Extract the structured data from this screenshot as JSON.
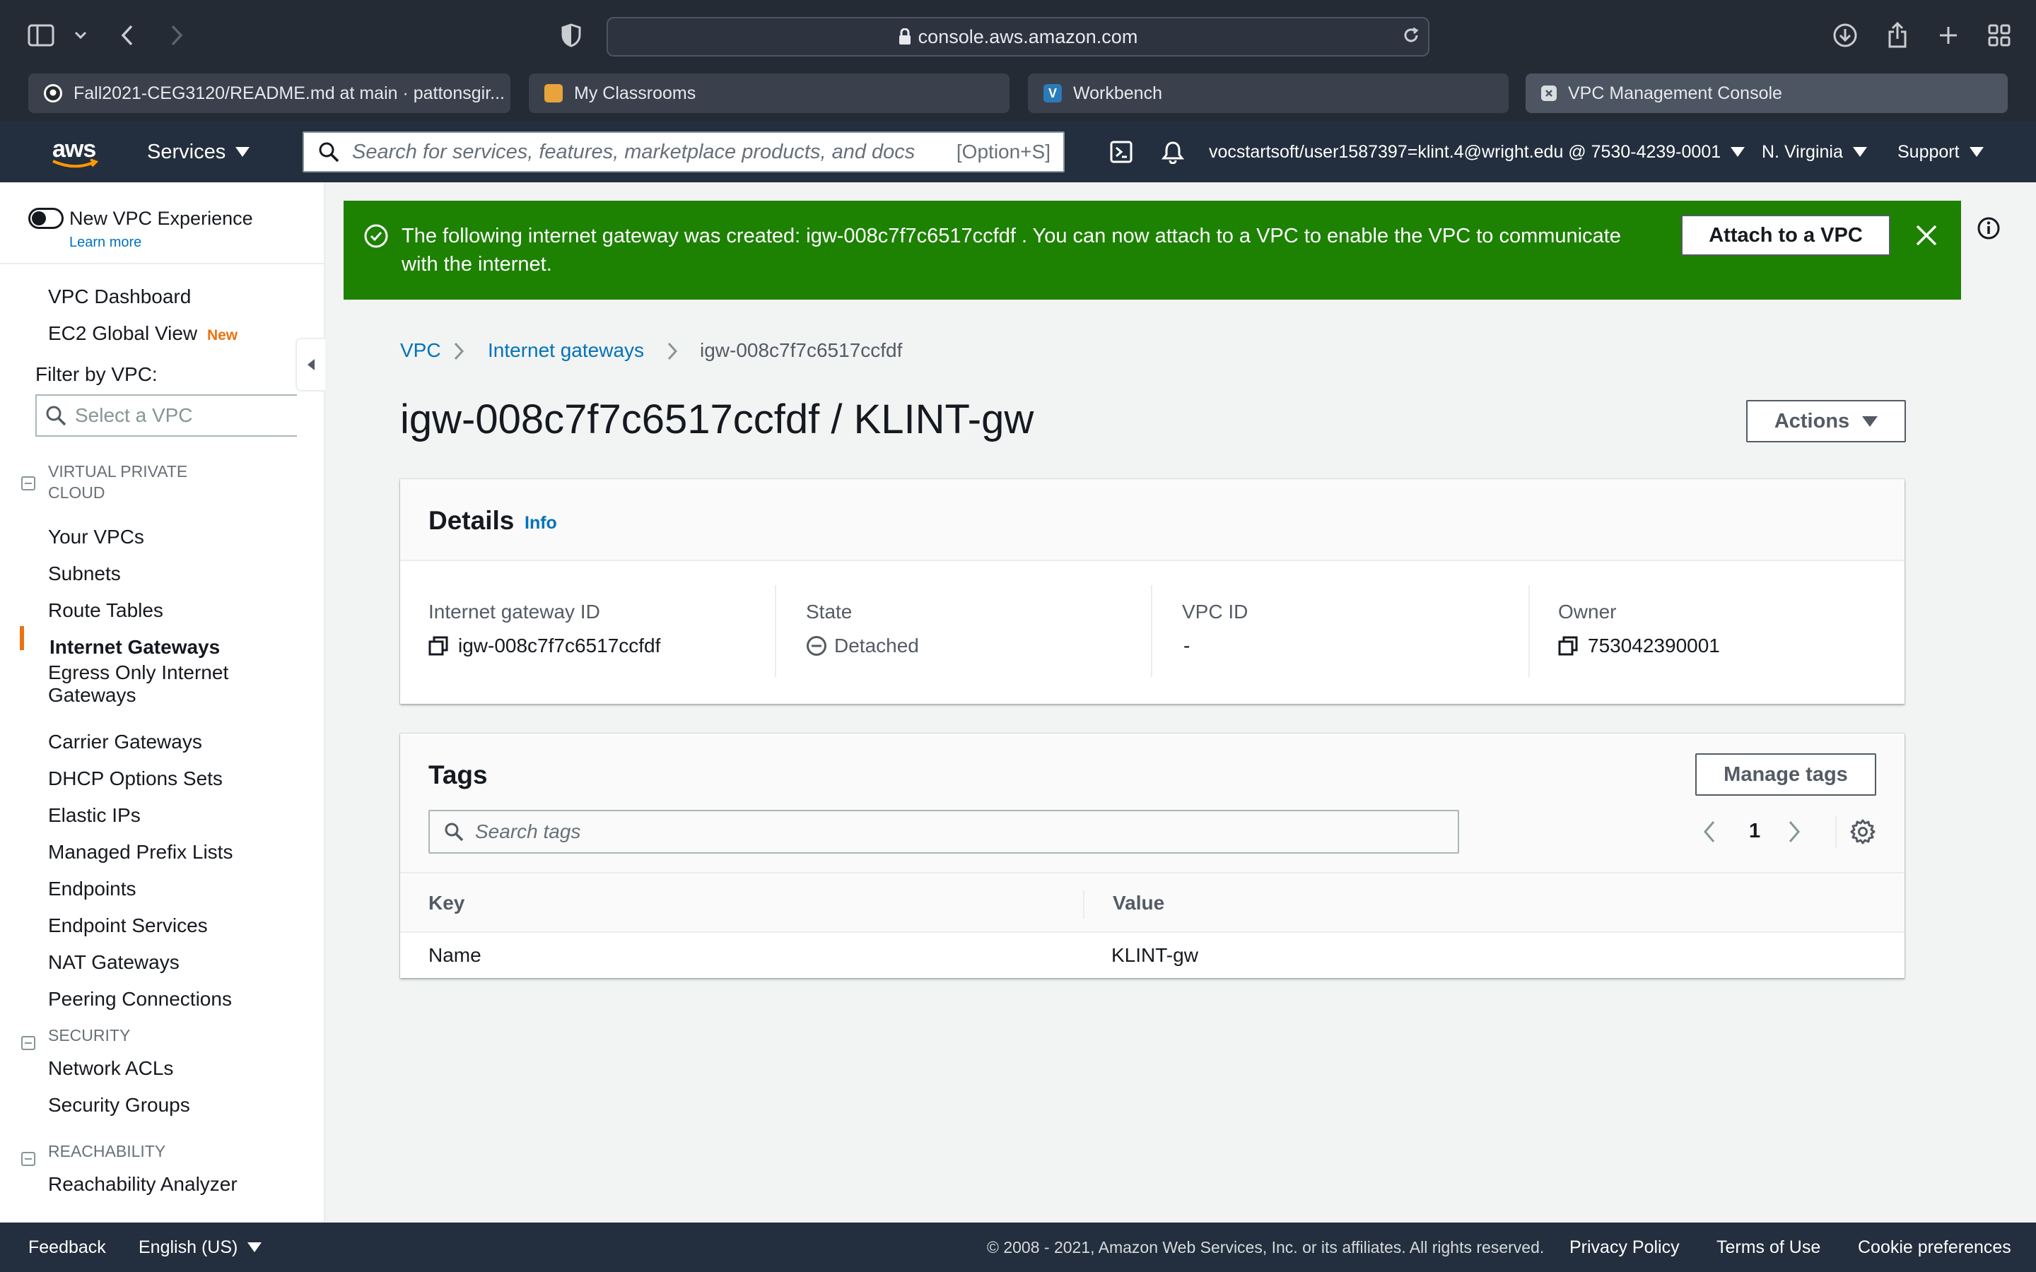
{
  "browser": {
    "url": "console.aws.amazon.com",
    "tabs": [
      {
        "label": "Fall2021-CEG3120/README.md at main · pattonsgir..."
      },
      {
        "label": "My Classrooms"
      },
      {
        "label": "Workbench"
      },
      {
        "label": "VPC Management Console"
      }
    ]
  },
  "aws_nav": {
    "logo": "aws",
    "services": "Services",
    "search_placeholder": "Search for services, features, marketplace products, and docs",
    "search_shortcut": "[Option+S]",
    "account": "vocstartsoft/user1587397=klint.4@wright.edu @ 7530-4239-0001",
    "region": "N. Virginia",
    "support": "Support"
  },
  "sidebar": {
    "new_experience": "New VPC Experience",
    "learn_more": "Learn more",
    "vpc_dashboard": "VPC Dashboard",
    "ec2_global_view": "EC2 Global View",
    "new_badge": "New",
    "filter_label": "Filter by VPC:",
    "filter_placeholder": "Select a VPC",
    "sections": {
      "vpc": "VIRTUAL PRIVATE CLOUD",
      "security": "SECURITY",
      "reachability": "REACHABILITY"
    },
    "vpc_items": [
      "Your VPCs",
      "Subnets",
      "Route Tables",
      "Internet Gateways",
      "Egress Only Internet Gateways",
      "Carrier Gateways",
      "DHCP Options Sets",
      "Elastic IPs",
      "Managed Prefix Lists",
      "Endpoints",
      "Endpoint Services",
      "NAT Gateways",
      "Peering Connections"
    ],
    "security_items": [
      "Network ACLs",
      "Security Groups"
    ],
    "reachability_items": [
      "Reachability Analyzer"
    ],
    "active_item": "Internet Gateways"
  },
  "flash": {
    "message": "The following internet gateway was created: igw-008c7f7c6517ccfdf . You can now attach to a VPC to enable the VPC to communicate with the internet.",
    "attach_button": "Attach to a VPC",
    "color": "#1d8102"
  },
  "breadcrumb": {
    "vpc": "VPC",
    "internet_gateways": "Internet gateways",
    "current": "igw-008c7f7c6517ccfdf"
  },
  "page": {
    "title": "igw-008c7f7c6517ccfdf / KLINT-gw",
    "actions": "Actions"
  },
  "details": {
    "title": "Details",
    "info": "Info",
    "gateway_id_label": "Internet gateway ID",
    "gateway_id": "igw-008c7f7c6517ccfdf",
    "state_label": "State",
    "state": "Detached",
    "vpc_id_label": "VPC ID",
    "vpc_id": "-",
    "owner_label": "Owner",
    "owner": "753042390001"
  },
  "tags": {
    "title": "Tags",
    "manage_button": "Manage tags",
    "search_placeholder": "Search tags",
    "page": "1",
    "columns": {
      "key": "Key",
      "value": "Value"
    },
    "rows": [
      {
        "key": "Name",
        "value": "KLINT-gw"
      }
    ]
  },
  "footer": {
    "feedback": "Feedback",
    "language": "English (US)",
    "copyright": "© 2008 - 2021, Amazon Web Services, Inc. or its affiliates. All rights reserved.",
    "privacy": "Privacy Policy",
    "terms": "Terms of Use",
    "cookies": "Cookie preferences"
  }
}
